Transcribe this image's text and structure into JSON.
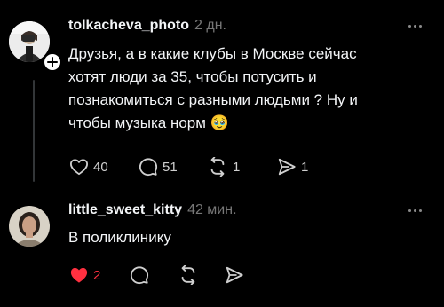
{
  "colors": {
    "background": "#000000",
    "text": "#f3f5f7",
    "secondary": "#777777",
    "like_active": "#ff3040"
  },
  "posts": [
    {
      "username": "tolkacheva_photo",
      "time": "2 дн.",
      "text_lines": [
        "Друзья, а в какие клубы в Москве сейчас",
        "хотят люди за 35, чтобы потусить и",
        "познакомиться с разными людьми ? Ну и",
        "чтобы музыка норм 🥹"
      ],
      "likes": "40",
      "comments": "51",
      "reposts": "1",
      "shares": "1",
      "icons": [
        "heart-icon",
        "comment-icon",
        "repost-icon",
        "share-icon",
        "more-icon",
        "plus-icon"
      ]
    },
    {
      "username": "little_sweet_kitty",
      "time": "42 мин.",
      "text_lines": [
        "В поликлинику"
      ],
      "likes": "2",
      "liked": true,
      "icons": [
        "heart-filled-icon",
        "comment-icon",
        "repost-icon",
        "share-icon",
        "more-icon"
      ]
    }
  ]
}
